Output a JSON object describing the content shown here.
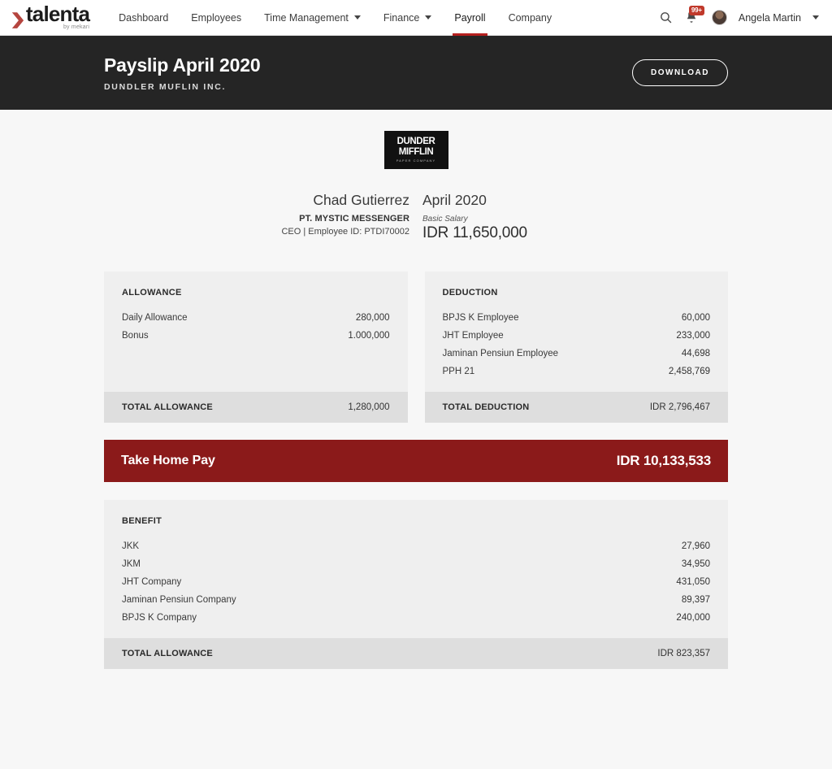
{
  "navbar": {
    "brand": {
      "name": "talenta",
      "sub": "by mekari",
      "chevron_icon": "chevron-right-icon"
    },
    "links": [
      {
        "label": "Dashboard",
        "has_caret": false,
        "active": false
      },
      {
        "label": "Employees",
        "has_caret": false,
        "active": false
      },
      {
        "label": "Time Management",
        "has_caret": true,
        "active": false
      },
      {
        "label": "Finance",
        "has_caret": true,
        "active": false
      },
      {
        "label": "Payroll",
        "has_caret": false,
        "active": true
      },
      {
        "label": "Company",
        "has_caret": false,
        "active": false
      }
    ],
    "search_icon": "search-icon",
    "notifications": {
      "icon": "bell-icon",
      "badge": "99+",
      "badge_color": "#c0392b"
    },
    "user": {
      "name": "Angela Martin",
      "avatar_icon": "user-avatar"
    },
    "active_underline_color": "#b5201f"
  },
  "page_header": {
    "title": "Payslip April 2020",
    "subtitle": "DUNDLER MUFLIN INC.",
    "download_label": "DOWNLOAD",
    "background": "#252525"
  },
  "payslip": {
    "logo": {
      "line1": "DUNDER",
      "line2": "MIFFLIN",
      "line3": "PAPER COMPANY"
    },
    "employee": {
      "name": "Chad Gutierrez",
      "company": "PT. MYSTIC MESSENGER",
      "role_and_id": "CEO | Employee ID: PTDI70002"
    },
    "period": "April 2020",
    "basic_salary_label": "Basic Salary",
    "basic_salary_value": "IDR 11,650,000",
    "allowance": {
      "title": "ALLOWANCE",
      "items": [
        {
          "label": "Daily Allowance",
          "amount": "280,000"
        },
        {
          "label": "Bonus",
          "amount": "1.000,000"
        }
      ],
      "total_label": "TOTAL ALLOWANCE",
      "total_amount": "1,280,000"
    },
    "deduction": {
      "title": "DEDUCTION",
      "items": [
        {
          "label": "BPJS K Employee",
          "amount": "60,000"
        },
        {
          "label": "JHT Employee",
          "amount": "233,000"
        },
        {
          "label": "Jaminan Pensiun Employee",
          "amount": "44,698"
        },
        {
          "label": "PPH 21",
          "amount": "2,458,769"
        }
      ],
      "total_label": "TOTAL DEDUCTION",
      "total_amount": "IDR 2,796,467"
    },
    "take_home_pay": {
      "label": "Take Home Pay",
      "amount": "IDR 10,133,533",
      "color": "#8b1a1a"
    },
    "benefit": {
      "title": "BENEFIT",
      "items": [
        {
          "label": "JKK",
          "amount": "27,960"
        },
        {
          "label": "JKM",
          "amount": "34,950"
        },
        {
          "label": "JHT Company",
          "amount": "431,050"
        },
        {
          "label": "Jaminan Pensiun Company",
          "amount": "89,397"
        },
        {
          "label": "BPJS K Company",
          "amount": "240,000"
        }
      ],
      "total_label": "TOTAL ALLOWANCE",
      "total_amount": "IDR 823,357"
    }
  }
}
